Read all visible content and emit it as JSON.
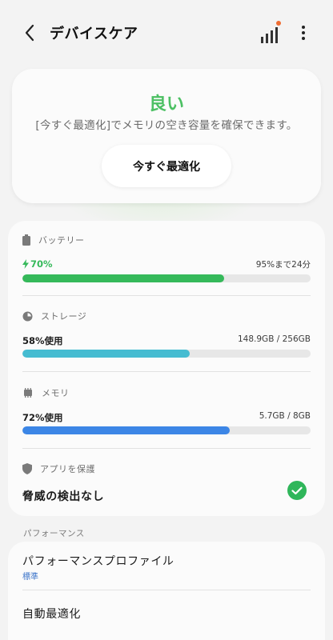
{
  "header": {
    "title": "デバイスケア",
    "back_icon": "back-arrow-icon",
    "signal_icon": "signal-bars-icon",
    "more_icon": "more-vertical-icon",
    "notification_dot_color": "#ef6d33"
  },
  "status": {
    "label": "良い",
    "description": "[今すぐ最適化]でメモリの空き容量を確保できます。",
    "button_label": "今すぐ最適化",
    "accent_color": "#4cc063"
  },
  "battery": {
    "label": "バッテリー",
    "value": "70%",
    "info": "95%まで24分",
    "progress": 0.7,
    "color": "#35b95a"
  },
  "storage": {
    "label": "ストレージ",
    "value": "58%使用",
    "info": "148.9GB / 256GB",
    "progress": 0.58,
    "color": "#45bcd1"
  },
  "memory": {
    "label": "メモリ",
    "value": "72%使用",
    "info": "5.7GB / 8GB",
    "progress": 0.72,
    "color": "#3c86e6"
  },
  "protection": {
    "label": "アプリを保護",
    "status": "脅威の検出なし",
    "check_color": "#2fb65a"
  },
  "performance": {
    "section_label": "パフォーマンス",
    "profile_title": "パフォーマンスプロファイル",
    "profile_value": "標準",
    "auto_optimize": "自動最適化"
  }
}
